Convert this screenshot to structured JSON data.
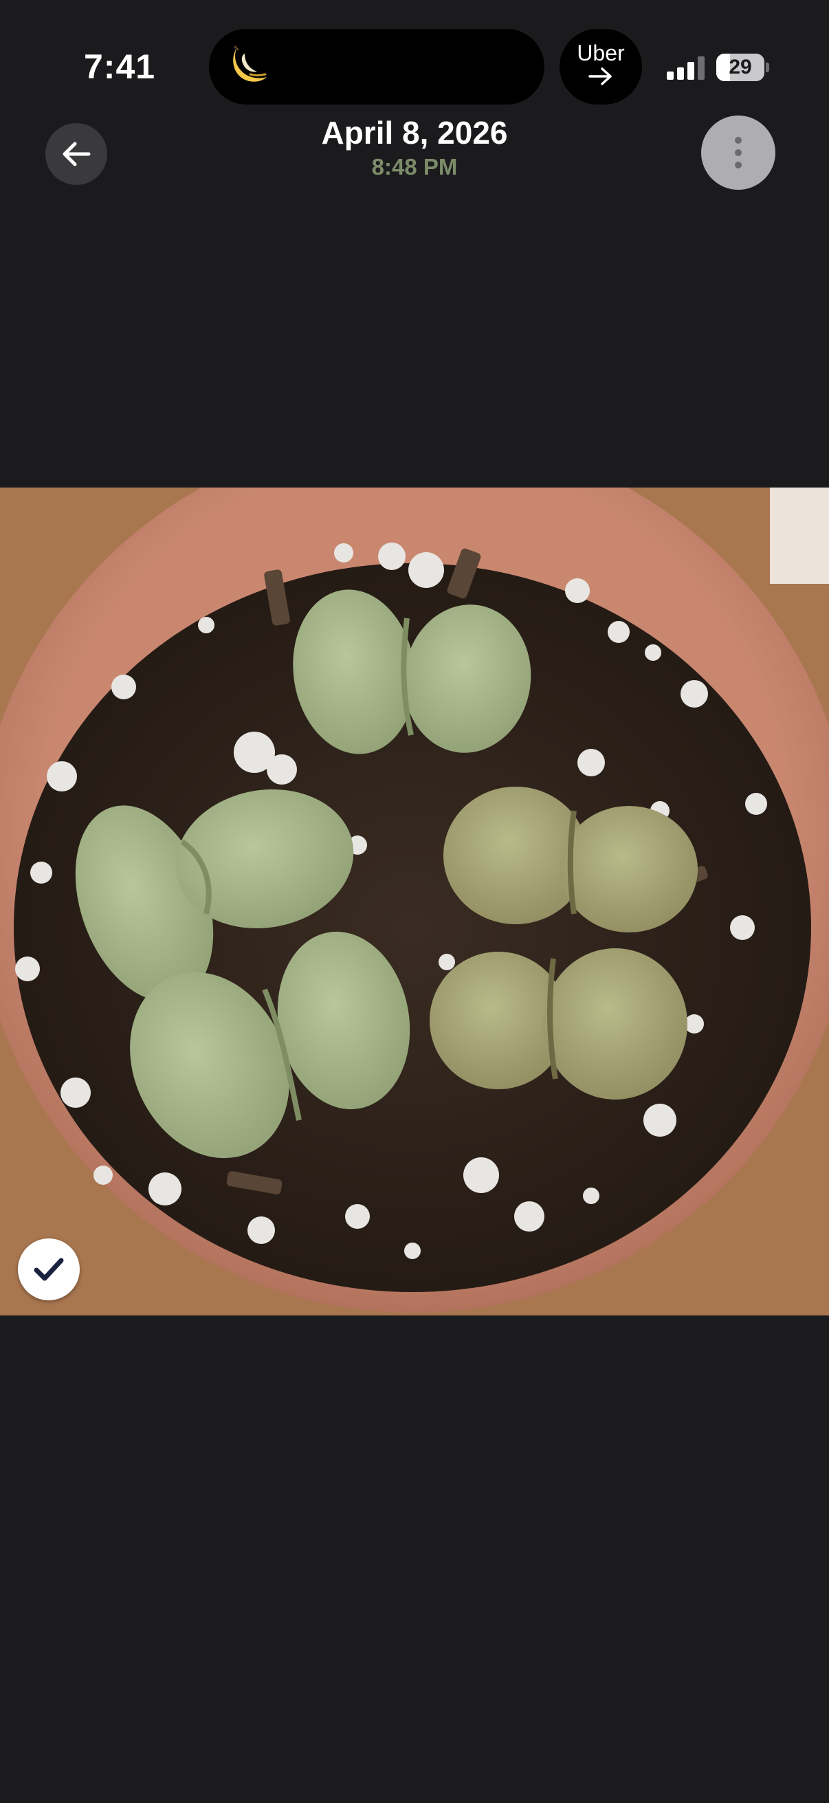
{
  "status_bar": {
    "time": "7:41",
    "live_activity_icon": "banana-app-icon",
    "uber_label": "Uber",
    "battery_percent": "29",
    "battery_level": 0.29,
    "signal_bars": 3
  },
  "header": {
    "date": "April 8, 2026",
    "time": "8:48 PM",
    "back_icon": "arrow-left-icon",
    "more_icon": "more-vertical-icon"
  },
  "photo": {
    "subject": "lithops-in-terracotta-pot",
    "selected": true,
    "selection_icon": "checkmark-icon"
  },
  "colors": {
    "background": "#1b1b1d",
    "subtitle_green": "#7c8b6a",
    "pot": "#c98770",
    "soil": "#2e2219",
    "lithops": "#a9b88c"
  }
}
